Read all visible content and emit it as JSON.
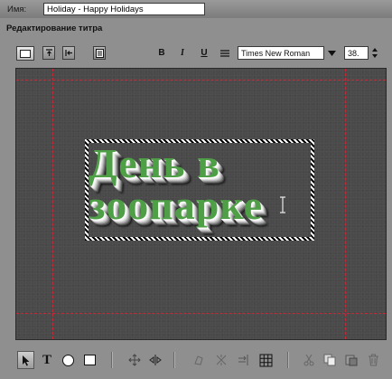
{
  "name_field": {
    "label": "Имя:",
    "value": "Holiday - Happy Holidays"
  },
  "section": {
    "title": "Редактирование титра"
  },
  "toolbar_top": {
    "left_buttons": [
      "title-frame-icon",
      "align-top-icon",
      "align-left-icon",
      "properties-icon"
    ],
    "style_buttons": {
      "bold": "B",
      "italic": "I",
      "underline": "U"
    },
    "align_icon": "justify-icon",
    "font": "Times New Roman",
    "size": "38."
  },
  "canvas": {
    "background": "#4a4a4a",
    "guide_color": "#c22a3a",
    "title_lines": [
      "День в",
      "зоопарке"
    ],
    "title_color": "#4f9f47"
  },
  "toolbar_bottom": {
    "tools": [
      "pointer-icon",
      "text-tool-icon",
      "ellipse-tool-icon",
      "rectangle-tool-icon"
    ],
    "text_tool_label": "T",
    "actions": [
      "move-icon",
      "mirror-icon",
      "rotate-icon",
      "shear-icon",
      "align-right-icon",
      "grid-icon",
      "cut-icon",
      "copy-icon",
      "paste-icon",
      "delete-icon"
    ]
  }
}
